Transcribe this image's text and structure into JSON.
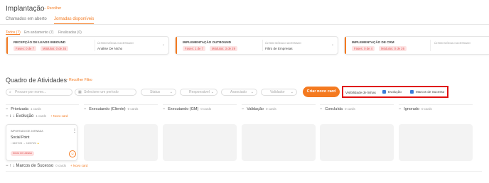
{
  "header": {
    "title": "Implantação",
    "collapse_label": "– Recolher"
  },
  "tabs": [
    {
      "label": "Chamados em aberto",
      "active": false
    },
    {
      "label": "Jornadas disponíveis",
      "active": true
    }
  ],
  "subtabs": [
    {
      "label": "Todos (7)",
      "active": true
    },
    {
      "label": "Em andamento (7)",
      "active": false
    },
    {
      "label": "Finalizadas (0)",
      "active": false
    }
  ],
  "journeys": [
    {
      "name": "RECEPÇÃO DE LEADS INBOUND",
      "phases": "Fases: 0 de 7",
      "modules": "Módulos: 0 de 35",
      "module_label": "ÚLTIMO MÓDULO ACESSADO",
      "module_value": "Análise De Nicho"
    },
    {
      "name": "IMPLEMENTAÇÃO OUTBOUND",
      "phases": "Fases: 1 de 7",
      "modules": "Módulos: 3 de 29",
      "module_label": "ÚLTIMO MÓDULO ACESSADO",
      "module_value": "Filtro de Empresas"
    },
    {
      "name": "IMPLEMENTAÇÃO DE CRM",
      "phases": "Fases: 0 de 4",
      "modules": "Módulos: 0 de 26",
      "module_label": "ÚLTIMO MÓDULO ACESSADO",
      "module_value": ""
    }
  ],
  "board": {
    "title": "Quadro de Atividades",
    "collapse_label": "– Recolher Filtro",
    "filters": {
      "search_placeholder": "Procure por nome...",
      "period_placeholder": "Selecione um período",
      "status": "Status",
      "responsible": "Responsável",
      "associated": "Associado",
      "validator": "Validador"
    },
    "create_button": "Criar novo card",
    "visibility_label": "Visibilidade de linhas",
    "visibility_options": [
      {
        "label": "Evolução",
        "checked": true
      },
      {
        "label": "Marcos de Sucesso",
        "checked": true
      }
    ]
  },
  "columns": [
    {
      "label": "Priorizada",
      "count": "1 cards"
    },
    {
      "label": "Executando (Cliente)",
      "count": "0 cards"
    },
    {
      "label": "Executando (GM)",
      "count": "0 cards"
    },
    {
      "label": "Validação",
      "count": "0 cards"
    },
    {
      "label": "Concluída",
      "count": "0 cards"
    },
    {
      "label": "Ignorado",
      "count": "0 cards"
    }
  ],
  "groups": [
    {
      "label": "Evolução",
      "count": "1 cards",
      "add_label": "+ Novo card"
    },
    {
      "label": "Marcos de Sucesso",
      "count": "0 cards",
      "add_label": "+ Novo card"
    }
  ],
  "task_card": {
    "category": "IMPORTADO DE JORNADA",
    "title": "Social Point",
    "start_date": "16/07/24",
    "end_date": "16/07/24",
    "badge": "Início em atraso"
  },
  "colors": {
    "accent": "#f47a20",
    "highlight_box": "#e01010",
    "checkbox": "#3b7bd8"
  }
}
